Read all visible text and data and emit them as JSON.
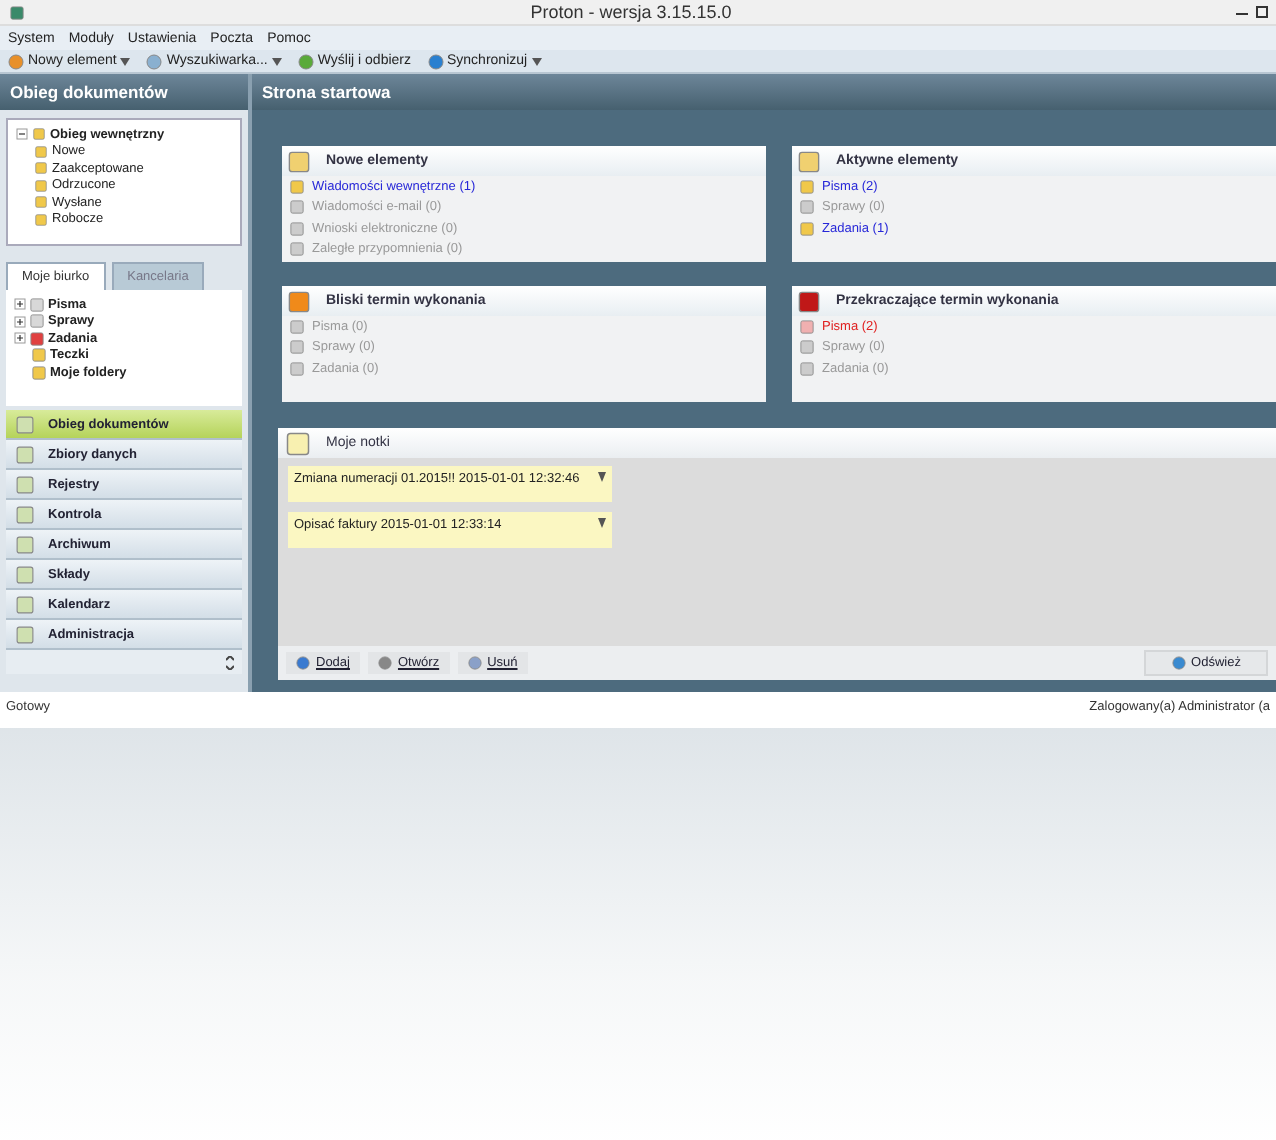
{
  "window": {
    "title": "Proton - wersja 3.15.15.0"
  },
  "menu": [
    "System",
    "Moduły",
    "Ustawienia",
    "Poczta",
    "Pomoc"
  ],
  "toolbar": [
    {
      "label": "Nowy element",
      "dropdown": true
    },
    {
      "label": "Wyszukiwarka...",
      "dropdown": true
    },
    {
      "label": "Wyślij i odbierz",
      "dropdown": false
    },
    {
      "label": "Synchronizuj",
      "dropdown": true
    }
  ],
  "sidebar": {
    "title": "Obieg dokumentów",
    "folder_tree": [
      {
        "label": "Obieg wewnętrzny",
        "bold": true,
        "expanded": true,
        "children": [
          {
            "label": "Nowe",
            "bold": false
          },
          {
            "label": "Zaakceptowane",
            "bold": false
          },
          {
            "label": "Odrzucone",
            "bold": false
          },
          {
            "label": "Wysłane",
            "bold": false
          },
          {
            "label": "Robocze",
            "bold": false
          }
        ]
      }
    ],
    "tabs": [
      {
        "label": "Moje biurko",
        "selected": true
      },
      {
        "label": "Kancelaria",
        "selected": false
      }
    ],
    "desk_tree": [
      {
        "label": "Pisma",
        "expandable": true
      },
      {
        "label": "Sprawy",
        "expandable": true
      },
      {
        "label": "Zadania",
        "expandable": true
      },
      {
        "label": "Teczki",
        "expandable": false
      },
      {
        "label": "Moje foldery",
        "expandable": false
      }
    ],
    "nav": [
      {
        "label": "Obieg dokumentów",
        "selected": true
      },
      {
        "label": "Zbiory danych",
        "selected": false
      },
      {
        "label": "Rejestry",
        "selected": false
      },
      {
        "label": "Kontrola",
        "selected": false
      },
      {
        "label": "Archiwum",
        "selected": false
      },
      {
        "label": "Składy",
        "selected": false
      },
      {
        "label": "Kalendarz",
        "selected": false
      },
      {
        "label": "Administracja",
        "selected": false
      }
    ]
  },
  "main": {
    "title": "Strona startowa",
    "cards": [
      {
        "title": "Nowe elementy",
        "items": [
          {
            "label": "Wiadomości wewnętrzne (1)",
            "kind": "active"
          },
          {
            "label": "Wiadomości e-mail (0)",
            "kind": "empty"
          },
          {
            "label": "Wnioski elektroniczne (0)",
            "kind": "empty"
          },
          {
            "label": "Zaległe przypomnienia (0)",
            "kind": "empty"
          }
        ]
      },
      {
        "title": "Aktywne elementy",
        "items": [
          {
            "label": "Pisma (2)",
            "kind": "active"
          },
          {
            "label": "Sprawy (0)",
            "kind": "empty"
          },
          {
            "label": "Zadania (1)",
            "kind": "active"
          }
        ]
      },
      {
        "title": "Bliski termin wykonania",
        "items": [
          {
            "label": "Pisma (0)",
            "kind": "empty"
          },
          {
            "label": "Sprawy (0)",
            "kind": "empty"
          },
          {
            "label": "Zadania (0)",
            "kind": "empty"
          }
        ]
      },
      {
        "title": "Przekraczające termin wykonania",
        "items": [
          {
            "label": "Pisma (2)",
            "kind": "overdue"
          },
          {
            "label": "Sprawy (0)",
            "kind": "empty"
          },
          {
            "label": "Zadania (0)",
            "kind": "empty"
          }
        ]
      }
    ],
    "notes": {
      "title": "Moje notki",
      "items": [
        {
          "text": "Zmiana numeracji 01.2015!! 2015-01-01 12:32:46"
        },
        {
          "text": "Opisać faktury 2015-01-01 12:33:14"
        }
      ],
      "buttons": [
        {
          "label": "Dodaj"
        },
        {
          "label": "Otwórz"
        },
        {
          "label": "Usuń"
        }
      ],
      "refresh": "Odśwież"
    }
  },
  "status_bar": {
    "left": "Gotowy",
    "right": "Zalogowany(a) Administrator (a"
  }
}
